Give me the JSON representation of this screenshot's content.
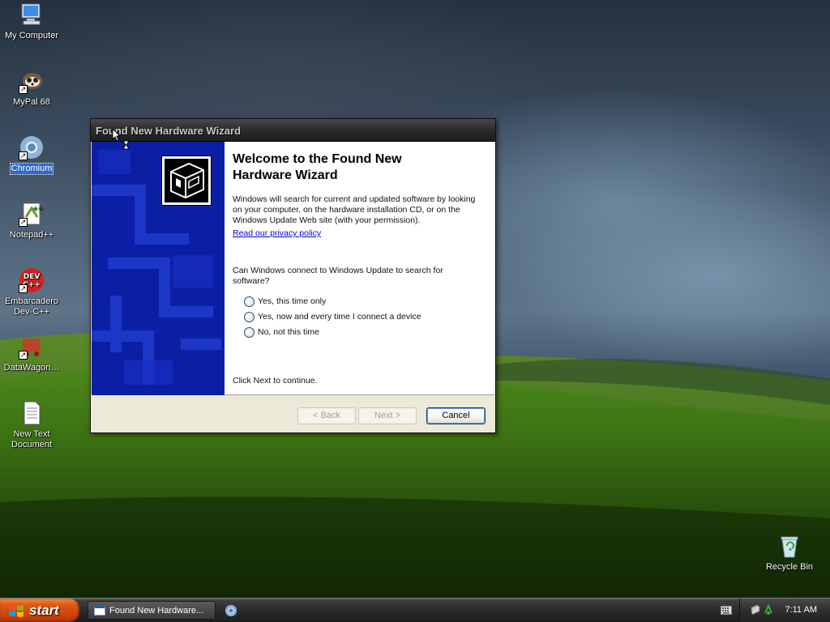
{
  "desktop": {
    "icons": [
      {
        "label": "My Computer",
        "icon": "computer-icon"
      },
      {
        "label": "MyPal 68",
        "icon": "mypal-icon"
      },
      {
        "label": "Chromium",
        "icon": "chromium-icon"
      },
      {
        "label": "Notepad++",
        "icon": "notepad-plus-plus-icon"
      },
      {
        "label": "Embarcadero Dev-C++",
        "icon": "devcpp-icon"
      },
      {
        "label": "DataWagon…",
        "icon": "datawagon-icon"
      },
      {
        "label": "New Text Document",
        "icon": "text-document-icon"
      },
      {
        "label": "Recycle Bin",
        "icon": "recycle-bin-icon"
      }
    ]
  },
  "wizard": {
    "title": "Found New Hardware Wizard",
    "heading": "Welcome to the Found New Hardware Wizard",
    "intro": "Windows will search for current and updated software by looking on your computer, on the hardware installation CD, or on the Windows Update Web site (with your permission).",
    "privacy_link": "Read our privacy policy",
    "question": "Can Windows connect to Windows Update to search for software?",
    "options": [
      "Yes, this time only",
      "Yes, now and every time I connect a device",
      "No, not this time"
    ],
    "continue_text": "Click Next to continue.",
    "buttons": {
      "back": "< Back",
      "next": "Next >",
      "cancel": "Cancel"
    }
  },
  "taskbar": {
    "start_label": "start",
    "tasks": [
      {
        "label": "Found New Hardware..."
      }
    ],
    "clock": "7:11 AM"
  },
  "colors": {
    "banner": "#0b1fa5",
    "start_button": "#e05a17",
    "link": "#0000e0"
  }
}
